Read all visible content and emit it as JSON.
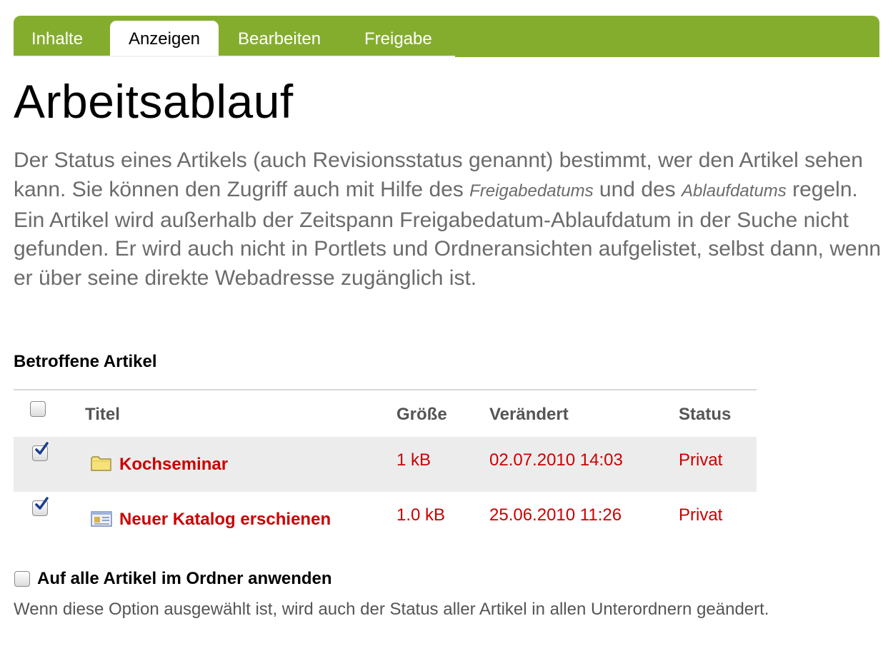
{
  "tabs": [
    {
      "label": "Inhalte",
      "active": false
    },
    {
      "label": "Anzeigen",
      "active": true
    },
    {
      "label": "Bearbeiten",
      "active": false
    },
    {
      "label": "Freigabe",
      "active": false
    }
  ],
  "page_title": "Arbeitsablauf",
  "description": {
    "part1": "Der Status eines Artikels (auch Revisionsstatus genannt) bestimmt, wer den Artikel sehen kann. Sie können den Zugriff auch mit Hilfe des ",
    "term1": "Freigabedatums",
    "part2": " und des ",
    "term2": "Ablaufdatums",
    "part3": " regeln. Ein Artikel wird außerhalb der Zeitspann Freigabedatum-Ablaufdatum in der Suche nicht gefunden. Er wird auch nicht in Portlets und Ordneransichten aufgelistet, selbst dann, wenn er über seine direkte Webadresse zugänglich ist."
  },
  "affected": {
    "heading": "Betroffene Artikel",
    "columns": {
      "title": "Titel",
      "size": "Größe",
      "modified": "Verändert",
      "status": "Status"
    },
    "select_all_checked": false,
    "rows": [
      {
        "checked": true,
        "icon": "folder-icon",
        "title": "Kochseminar",
        "size": "1 kB",
        "modified": "02.07.2010 14:03",
        "status": "Privat"
      },
      {
        "checked": true,
        "icon": "news-item-icon",
        "title": "Neuer Katalog erschienen",
        "size": "1.0 kB",
        "modified": "25.06.2010 11:26",
        "status": "Privat"
      }
    ]
  },
  "apply_all": {
    "checked": false,
    "label": "Auf alle Artikel im Ordner anwenden",
    "help": "Wenn diese Option ausgewählt ist, wird auch der Status aller Artikel in allen Unterordnern geändert."
  },
  "colors": {
    "tab_bar": "#84ad2e",
    "link_red": "#cc0000",
    "description_gray": "#6b6b6b",
    "row_highlight": "#ececec"
  }
}
